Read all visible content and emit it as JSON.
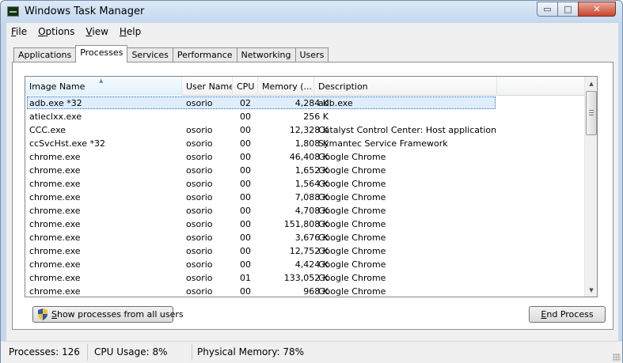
{
  "window": {
    "title": "Windows Task Manager",
    "controls": {
      "minimize": "▭",
      "maximize": "□",
      "close": "✕"
    }
  },
  "menu": [
    {
      "accel": "F",
      "rest": "ile"
    },
    {
      "accel": "O",
      "rest": "ptions"
    },
    {
      "accel": "V",
      "rest": "iew"
    },
    {
      "accel": "H",
      "rest": "elp"
    }
  ],
  "tabs": [
    "Applications",
    "Processes",
    "Services",
    "Performance",
    "Networking",
    "Users"
  ],
  "active_tab": "Processes",
  "columns": [
    "Image Name",
    "User Name",
    "CPU",
    "Memory (...",
    "Description"
  ],
  "rows": [
    {
      "image": "adb.exe *32",
      "user": "osorio",
      "cpu": "02",
      "memory": "4,284 K",
      "description": "adb.exe",
      "selected": true
    },
    {
      "image": "atieclxx.exe",
      "user": "",
      "cpu": "00",
      "memory": "256 K",
      "description": ""
    },
    {
      "image": "CCC.exe",
      "user": "osorio",
      "cpu": "00",
      "memory": "12,328 K",
      "description": "Catalyst Control Center: Host application"
    },
    {
      "image": "ccSvcHst.exe *32",
      "user": "osorio",
      "cpu": "00",
      "memory": "1,808 K",
      "description": "Symantec Service Framework"
    },
    {
      "image": "chrome.exe",
      "user": "osorio",
      "cpu": "00",
      "memory": "46,408 K",
      "description": "Google Chrome"
    },
    {
      "image": "chrome.exe",
      "user": "osorio",
      "cpu": "00",
      "memory": "1,652 K",
      "description": "Google Chrome"
    },
    {
      "image": "chrome.exe",
      "user": "osorio",
      "cpu": "00",
      "memory": "1,564 K",
      "description": "Google Chrome"
    },
    {
      "image": "chrome.exe",
      "user": "osorio",
      "cpu": "00",
      "memory": "7,088 K",
      "description": "Google Chrome"
    },
    {
      "image": "chrome.exe",
      "user": "osorio",
      "cpu": "00",
      "memory": "4,708 K",
      "description": "Google Chrome"
    },
    {
      "image": "chrome.exe",
      "user": "osorio",
      "cpu": "00",
      "memory": "151,808 K",
      "description": "Google Chrome"
    },
    {
      "image": "chrome.exe",
      "user": "osorio",
      "cpu": "00",
      "memory": "3,676 K",
      "description": "Google Chrome"
    },
    {
      "image": "chrome.exe",
      "user": "osorio",
      "cpu": "00",
      "memory": "12,752 K",
      "description": "Google Chrome"
    },
    {
      "image": "chrome.exe",
      "user": "osorio",
      "cpu": "00",
      "memory": "4,424 K",
      "description": "Google Chrome"
    },
    {
      "image": "chrome.exe",
      "user": "osorio",
      "cpu": "01",
      "memory": "133,052 K",
      "description": "Google Chrome"
    },
    {
      "image": "chrome.exe",
      "user": "osorio",
      "cpu": "00",
      "memory": "968 K",
      "description": "Google Chrome"
    }
  ],
  "buttons": {
    "show_all": {
      "accel": "S",
      "rest": "how processes from all users"
    },
    "end_process": {
      "accel": "E",
      "rest": "nd Process"
    }
  },
  "status": {
    "processes": "Processes: 126",
    "cpu_usage": "CPU Usage: 8%",
    "physical_memory": "Physical Memory: 78%"
  },
  "colors": {
    "selection_border": "#2c6bb5",
    "selection_fill": "#dfeefc",
    "frame": "#c4d8ee"
  }
}
